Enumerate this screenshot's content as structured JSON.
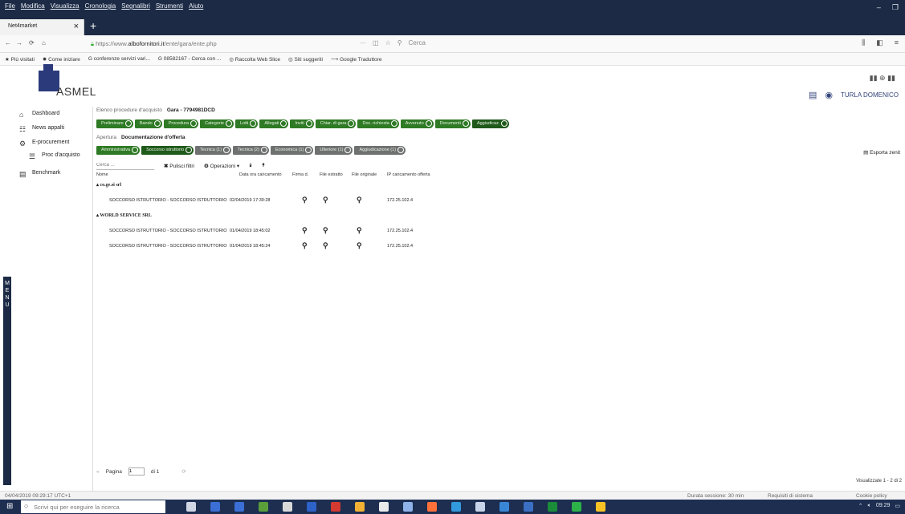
{
  "browser": {
    "menu": [
      "File",
      "Modifica",
      "Visualizza",
      "Cronologia",
      "Segnalibri",
      "Strumenti",
      "Aiuto"
    ],
    "tab_title": "Net4market",
    "url_prefix": "https://www.",
    "url_domain": "albofornitori.it",
    "url_rest": "/ente/gara/ente.php",
    "search_placeholder": "Cerca",
    "bookmarks": [
      "Più visitati",
      "Come iniziare",
      "conferenze servizi vari...",
      "08582167 - Cerca con ...",
      "Raccolta Web Slice",
      "Siti suggeriti",
      "Google Traduttore"
    ]
  },
  "app": {
    "logo_text": "ASMEL",
    "user_name": "TURLA DOMENICO",
    "sidebar": [
      {
        "icon": "home-icon",
        "label": "Dashboard"
      },
      {
        "icon": "news-icon",
        "label": "News appalti"
      },
      {
        "icon": "eprocurement-icon",
        "label": "E-procurement"
      },
      {
        "icon": "list-icon",
        "label": "Proc d'acquisto"
      },
      {
        "icon": "benchmark-icon",
        "label": "Benchmark"
      }
    ],
    "menu_strip_letters": [
      "M",
      "E",
      "N",
      "U"
    ],
    "breadcrumb1": [
      "Elenco procedure d'acquisto",
      "Gara - 7794981DCD"
    ],
    "steps1": [
      {
        "label": "Preliminare",
        "style": "green"
      },
      {
        "label": "Bando",
        "style": "green"
      },
      {
        "label": "Procedura",
        "style": "green"
      },
      {
        "label": "Categorie",
        "style": "green"
      },
      {
        "label": "Lotti",
        "style": "green"
      },
      {
        "label": "Allegati",
        "style": "green"
      },
      {
        "label": "Inviti",
        "style": "green"
      },
      {
        "label": "Chiar. di gara",
        "style": "green"
      },
      {
        "label": "Doc. richiesta",
        "style": "green"
      },
      {
        "label": "Avvenuto",
        "style": "green"
      },
      {
        "label": "Documenti",
        "style": "green"
      },
      {
        "label": "Aggiudicaz.",
        "style": "dark"
      }
    ],
    "breadcrumb2": [
      "Apertura",
      "Documentazione d'offerta"
    ],
    "steps2": [
      {
        "label": "Amministrativa",
        "style": "green"
      },
      {
        "label": "Soccorso istruttorio",
        "style": "dark"
      },
      {
        "label": "Tecnica (1)",
        "style": "gray"
      },
      {
        "label": "Tecnica (2)",
        "style": "gray"
      },
      {
        "label": "Economica (1)",
        "style": "gray"
      },
      {
        "label": "Ulteriore (1)",
        "style": "gray"
      },
      {
        "label": "Aggiudicazione (1)",
        "style": "gray"
      }
    ],
    "toolbar": {
      "filter_placeholder": "Cerca ...",
      "clear_filters": "Pulisci filtri",
      "operations": "Operazioni",
      "export": "Esporta zenit"
    },
    "table": {
      "columns": [
        "Nome",
        "Data ora caricamento",
        "Firma d.",
        "File estratto",
        "File originale",
        "IP caricamento offerta"
      ],
      "groups": [
        {
          "name": "co.ge.si srl",
          "rows": [
            {
              "name": "SOCCORSO ISTRUTTORIO - SOCCORSO ISTRUTTORIO",
              "datetime": "02/04/2019 17:30:28",
              "ip": "172.25.102.4"
            }
          ]
        },
        {
          "name": "WORLD SERVICE SRL",
          "rows": [
            {
              "name": "SOCCORSO ISTRUTTORIO - SOCCORSO ISTRUTTORIO",
              "datetime": "01/04/2019 18:45:02",
              "ip": "172.25.102.4"
            },
            {
              "name": "SOCCORSO ISTRUTTORIO - SOCCORSO ISTRUTTORIO",
              "datetime": "01/04/2019 18:45:24",
              "ip": "172.25.102.4"
            }
          ]
        }
      ]
    },
    "pager": {
      "label": "Pagina",
      "value": "1",
      "of": "di 1"
    },
    "view_info": "Visualizzate 1 - 2 di 2"
  },
  "statusbar": {
    "left": "04/04/2019 09:29:17 UTC+1",
    "session": "Durata sessione: 30 min",
    "requirements": "Requisiti di sistema",
    "privacy": "Cookie policy"
  },
  "taskbar": {
    "search_placeholder": "Scrivi qui per eseguire la ricerca",
    "time": "09:29"
  },
  "colors": {
    "green_step": "#2f7a25",
    "gray_step": "#6f7170",
    "taskbar": "#1d2e50",
    "menubar": "#1c2a45"
  }
}
